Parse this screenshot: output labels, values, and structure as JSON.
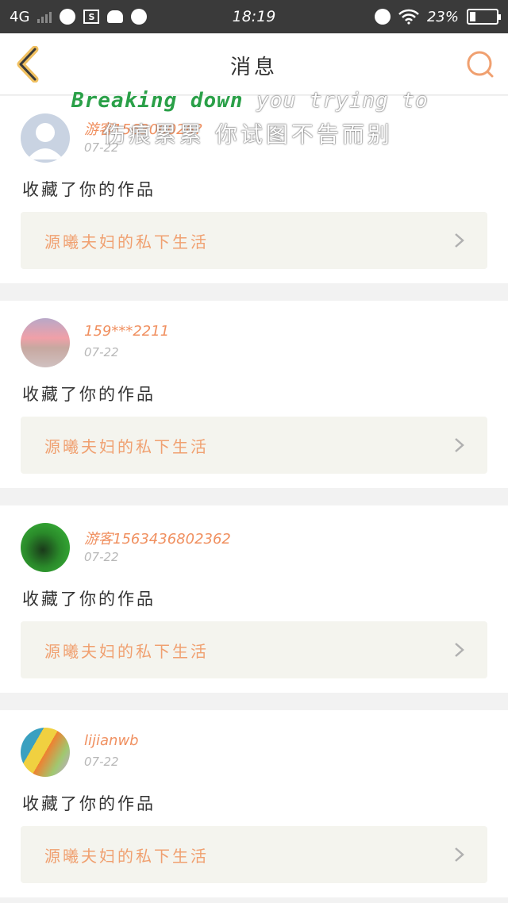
{
  "status_bar": {
    "network": "4G",
    "time": "18:19",
    "battery": "23%",
    "battery_level": 0.23
  },
  "header": {
    "title": "消息",
    "back_icon": "chevron-left-icon",
    "search_icon": "search-icon",
    "accent_color": "#f0a070"
  },
  "watermark": {
    "en_green": "Breaking down",
    "en_rest": "you trying to",
    "zh": "伤痕累累 你试图不告而别"
  },
  "notifications": [
    {
      "username": "游客156306026?",
      "date": "07-22",
      "action": "收藏了你的作品",
      "work_title": "源曦夫妇的私下生活",
      "avatar": "default"
    },
    {
      "username": "159***2211",
      "date": "07-22",
      "action": "收藏了你的作品",
      "work_title": "源曦夫妇的私下生活",
      "avatar": "sunset"
    },
    {
      "username": "游客1563436802362",
      "date": "07-22",
      "action": "收藏了你的作品",
      "work_title": "源曦夫妇的私下生活",
      "avatar": "green"
    },
    {
      "username": "lijianwb",
      "date": "07-22",
      "action": "收藏了你的作品",
      "work_title": "源曦夫妇的私下生活",
      "avatar": "art"
    }
  ]
}
